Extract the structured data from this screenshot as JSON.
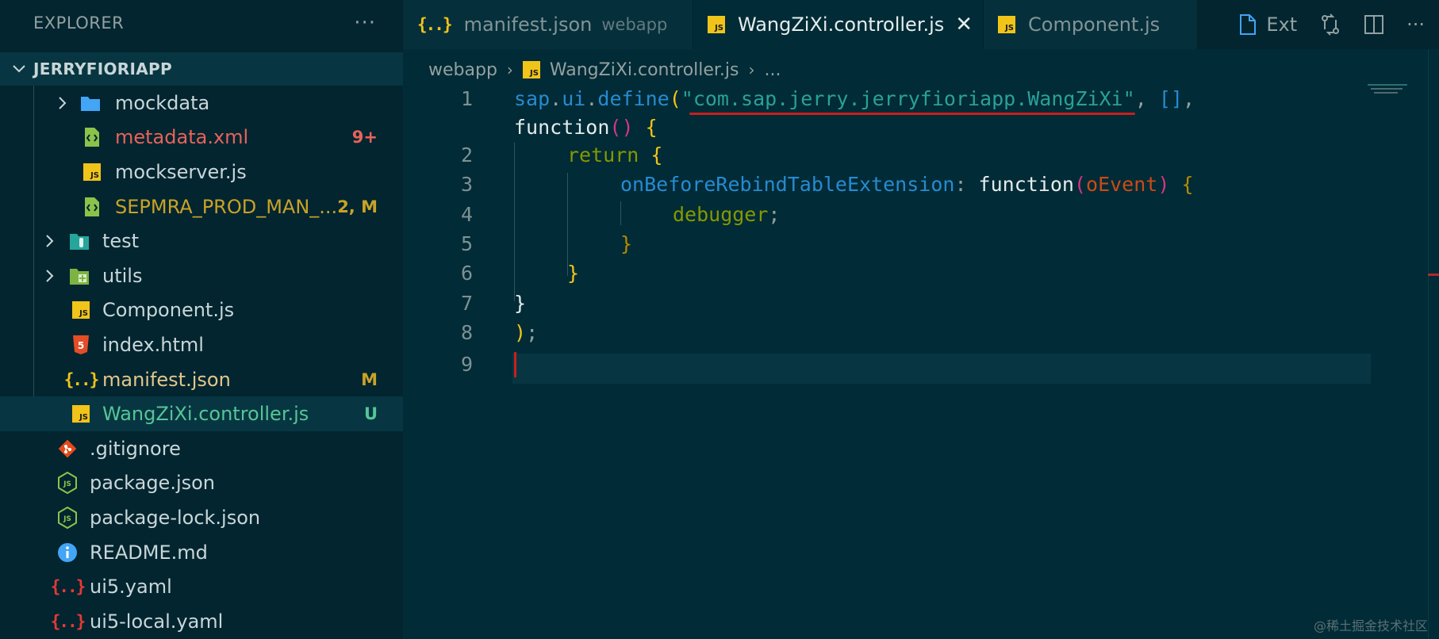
{
  "sidebar": {
    "title": "EXPLORER",
    "more": "···",
    "root_label": "JERRYFIORIAPP",
    "items": [
      {
        "label": "mockdata",
        "icon": "folder-icon",
        "badge": ""
      },
      {
        "label": "metadata.xml",
        "icon": "xml-file-icon",
        "badge": "9+"
      },
      {
        "label": "mockserver.js",
        "icon": "js-file-icon",
        "badge": ""
      },
      {
        "label": "SEPMRA_PROD_MAN_...",
        "icon": "xml-file-icon",
        "badge": "2, M"
      },
      {
        "label": "test",
        "icon": "test-folder-icon",
        "badge": ""
      },
      {
        "label": "utils",
        "icon": "utils-folder-icon",
        "badge": ""
      },
      {
        "label": "Component.js",
        "icon": "js-file-icon",
        "badge": ""
      },
      {
        "label": "index.html",
        "icon": "html-file-icon",
        "badge": ""
      },
      {
        "label": "manifest.json",
        "icon": "json-file-icon",
        "badge": "M"
      },
      {
        "label": "WangZiXi.controller.js",
        "icon": "js-file-icon",
        "badge": "U"
      },
      {
        "label": ".gitignore",
        "icon": "git-icon",
        "badge": ""
      },
      {
        "label": "package.json",
        "icon": "node-icon",
        "badge": ""
      },
      {
        "label": "package-lock.json",
        "icon": "node-icon",
        "badge": ""
      },
      {
        "label": "README.md",
        "icon": "info-icon",
        "badge": ""
      },
      {
        "label": "ui5.yaml",
        "icon": "yaml-file-icon",
        "badge": ""
      },
      {
        "label": "ui5-local.yaml",
        "icon": "yaml-file-icon",
        "badge": ""
      }
    ]
  },
  "tabs": [
    {
      "label": "manifest.json",
      "description": "webapp",
      "icon": "json-file-icon",
      "active": false
    },
    {
      "label": "WangZiXi.controller.js",
      "description": "",
      "icon": "js-file-icon",
      "active": true
    },
    {
      "label": "Component.js",
      "description": "",
      "icon": "js-file-icon",
      "active": false
    }
  ],
  "tab_actions": {
    "ext_label": "Ext"
  },
  "breadcrumb": {
    "folder": "webapp",
    "file": "WangZiXi.controller.js",
    "ellipsis": "..."
  },
  "editor": {
    "line_numbers": [
      "1",
      "2",
      "3",
      "4",
      "5",
      "6",
      "7",
      "8",
      "9"
    ],
    "line1": {
      "a": "sap",
      "b": ".",
      "c": "ui",
      "d": ".",
      "e": "define",
      "f": "(",
      "g": "\"com.sap.jerry.jerryfioriapp.WangZiXi\"",
      "h": ", ",
      "i": "[]",
      "j": ","
    },
    "line1b": {
      "a": "function",
      "b": "()",
      "c": " {"
    },
    "line2": {
      "a": "return",
      "b": " {"
    },
    "line3": {
      "a": "onBeforeRebindTableExtension",
      "b": ": ",
      "c": "function",
      "d": "(",
      "e": "oEvent",
      "f": ")",
      "g": " {"
    },
    "line4": {
      "a": "debugger",
      "b": ";"
    },
    "line5": {
      "a": "}"
    },
    "line6": {
      "a": "}"
    },
    "line7": {
      "a": "}"
    },
    "line8": {
      "a": ")",
      "b": ";"
    }
  },
  "watermark": "@稀土掘金技术社区",
  "colors": {
    "background": "#012b36",
    "sidebar": "#022530",
    "string": "#2aa198",
    "keyword": "#859900",
    "accent_red": "#cb1e1e"
  }
}
